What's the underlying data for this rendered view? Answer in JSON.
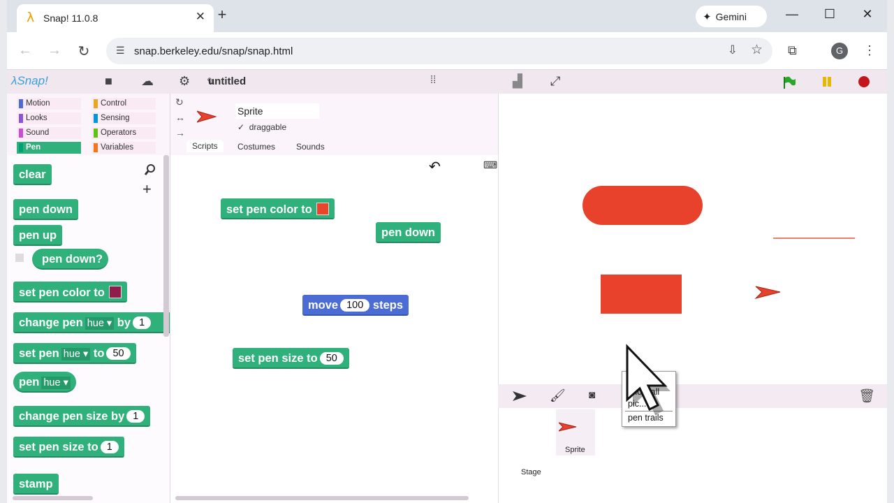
{
  "browser": {
    "tab_title": "Snap! 11.0.8",
    "tab_icon": "λ",
    "gemini_label": "Gemini",
    "url": "snap.berkeley.edu/snap/snap.html",
    "avatar_letter": "G"
  },
  "snap": {
    "logo": "λSnap!",
    "project_name": "untitled",
    "categories": [
      {
        "label": "Motion",
        "color": "#4a6cd4"
      },
      {
        "label": "Control",
        "color": "#e6a822"
      },
      {
        "label": "Looks",
        "color": "#8a55d7"
      },
      {
        "label": "Sensing",
        "color": "#0494dc"
      },
      {
        "label": "Sound",
        "color": "#cf4ad9"
      },
      {
        "label": "Operators",
        "color": "#62c213"
      },
      {
        "label": "Pen",
        "color": "#00a178"
      },
      {
        "label": "Variables",
        "color": "#f3761d"
      }
    ],
    "selected_category": "Pen",
    "palette": {
      "clear": "clear",
      "pen_down": "pen down",
      "pen_up": "pen up",
      "pen_down_q": "pen down?",
      "set_pen_color": "set pen color to",
      "set_pen_color_swatch": "#8f1d4b",
      "change_pen": "change pen",
      "change_pen_dd": "hue",
      "change_pen_by": "by",
      "change_pen_val": "1",
      "set_pen": "set pen",
      "set_pen_dd": "hue",
      "set_pen_to": "to",
      "set_pen_val": "50",
      "pen_reporter": "pen",
      "pen_reporter_dd": "hue",
      "change_size": "change pen size by",
      "change_size_val": "1",
      "set_size": "set pen size to",
      "set_size_val": "1",
      "stamp": "stamp"
    },
    "sprite": {
      "name": "Sprite",
      "draggable": "draggable",
      "tabs": [
        "Scripts",
        "Costumes",
        "Sounds"
      ]
    },
    "scripts": {
      "set_pen_color": "set pen color to",
      "set_pen_color_swatch": "#e8452c",
      "pen_down": "pen down",
      "move": "move",
      "move_val": "100",
      "steps": "steps",
      "set_size": "set pen size to",
      "set_size_val": "50"
    },
    "context_menu": [
      "edit",
      "show all",
      "pic...",
      "pen trails"
    ],
    "corral": {
      "sprite_label": "Sprite",
      "stage_label": "Stage"
    },
    "colors": {
      "pen_green": "#30b07a",
      "motion_blue": "#4a6cd4",
      "drawn_red": "#e8412c"
    }
  }
}
